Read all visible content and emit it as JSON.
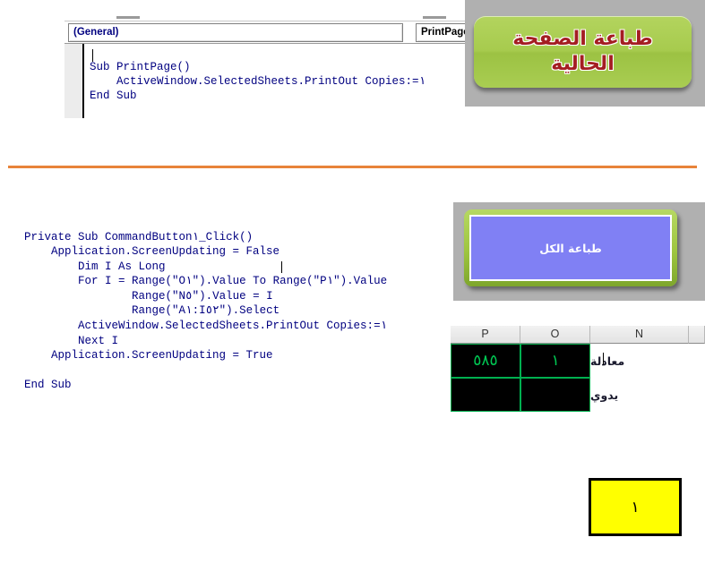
{
  "editor": {
    "object_dropdown": "(General)",
    "procedure_dropdown": "PrintPage",
    "code": "Sub PrintPage()\n    ActiveWindow.SelectedSheets.PrintOut Copies:=١\nEnd Sub"
  },
  "buttons": {
    "print_current_page_line1": "طباعة الصفحة",
    "print_current_page_line2": "الحالية",
    "print_all": "طباعة الكل"
  },
  "main_code": "Private Sub CommandButton١_Click()\n    Application.ScreenUpdating = False\n        Dim I As Long\n        For I = Range(\"O١\").Value To Range(\"P١\").Value\n                Range(\"N٥\").Value = I\n                Range(\"A١:I٥٢\").Select\n        ActiveWindow.SelectedSheets.PrintOut Copies:=١\n        Next I\n    Application.ScreenUpdating = True\n\nEnd Sub",
  "sheet": {
    "headers": {
      "p": "P",
      "o": "O",
      "n": "N",
      "edge": ""
    },
    "row1": {
      "p": "٥٨٥",
      "o": "١",
      "label": "معادلة"
    },
    "row2": {
      "p": "",
      "o": "",
      "label": "يدوي"
    }
  },
  "page_number_box": {
    "value": "١"
  },
  "colors": {
    "green_button": "#a9cd52",
    "red_text": "#a41e22",
    "purple_fill": "#8080f4",
    "orange_divider": "#e8833a",
    "cell_green_text": "#00c853",
    "yellow_box": "#ffff00",
    "code_blue": "#000080"
  }
}
